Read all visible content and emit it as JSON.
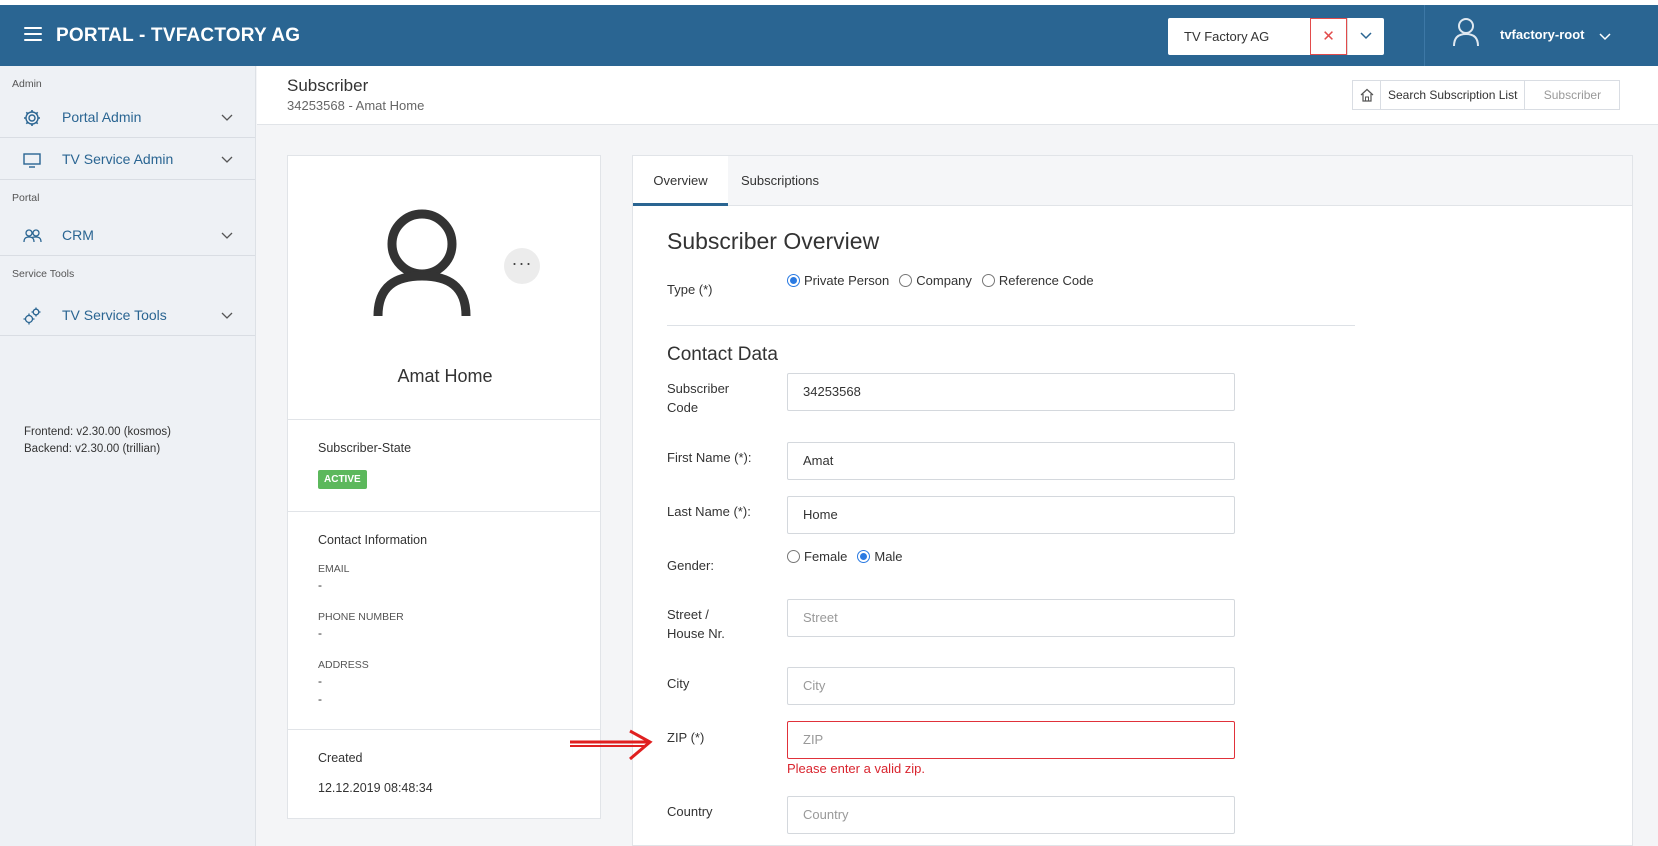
{
  "header": {
    "brand": "PORTAL - TVFACTORY AG",
    "tenant": "TV Factory AG",
    "clear_glyph": "✕",
    "username": "tvfactory-root"
  },
  "sidebar": {
    "sections": [
      {
        "title": "Admin"
      },
      {
        "title": "Portal"
      },
      {
        "title": "Service Tools"
      }
    ],
    "items": [
      {
        "label": "Portal Admin",
        "icon": "gear-icon"
      },
      {
        "label": "TV Service Admin",
        "icon": "monitor-icon"
      },
      {
        "label": "CRM",
        "icon": "users-icon"
      },
      {
        "label": "TV Service Tools",
        "icon": "cogs-icon"
      }
    ],
    "frontend_version": "Frontend: v2.30.00 (kosmos)",
    "backend_version": "Backend: v2.30.00 (trillian)"
  },
  "page": {
    "title": "Subscriber",
    "subtitle": "34253568 - Amat Home",
    "breadcrumbs": [
      "Search Subscription List",
      "Subscriber"
    ]
  },
  "profile": {
    "name": "Amat Home",
    "more_glyph": "···",
    "state_label": "Subscriber-State",
    "state_value": "ACTIVE",
    "contact_title": "Contact Information",
    "email_label": "EMAIL",
    "email_value": "-",
    "phone_label": "PHONE NUMBER",
    "phone_value": "-",
    "address_label": "ADDRESS",
    "address_line1": "-",
    "address_line2": "-",
    "created_label": "Created",
    "created_value": "12.12.2019 08:48:34"
  },
  "tabs": [
    "Overview",
    "Subscriptions"
  ],
  "overview": {
    "heading": "Subscriber Overview",
    "type_label": "Type (*)",
    "type_options": [
      "Private Person",
      "Company",
      "Reference Code"
    ],
    "type_selected": "Private Person",
    "contact_heading": "Contact Data",
    "subscriber_code_label": "Subscriber Code",
    "subscriber_code_value": "34253568",
    "first_name_label": "First Name (*):",
    "first_name_value": "Amat",
    "last_name_label": "Last Name (*):",
    "last_name_value": "Home",
    "gender_label": "Gender:",
    "gender_options": [
      "Female",
      "Male"
    ],
    "gender_selected": "Male",
    "street_label": "Street / House Nr.",
    "street_placeholder": "Street",
    "city_label": "City",
    "city_placeholder": "City",
    "zip_label": "ZIP (*)",
    "zip_placeholder": "ZIP",
    "zip_error": "Please enter a valid zip.",
    "country_label": "Country",
    "country_placeholder": "Country"
  },
  "colors": {
    "primary": "#2a6592",
    "active_badge": "#5cb85c",
    "error": "#d9252f",
    "radio_on": "#2a7ae2"
  }
}
